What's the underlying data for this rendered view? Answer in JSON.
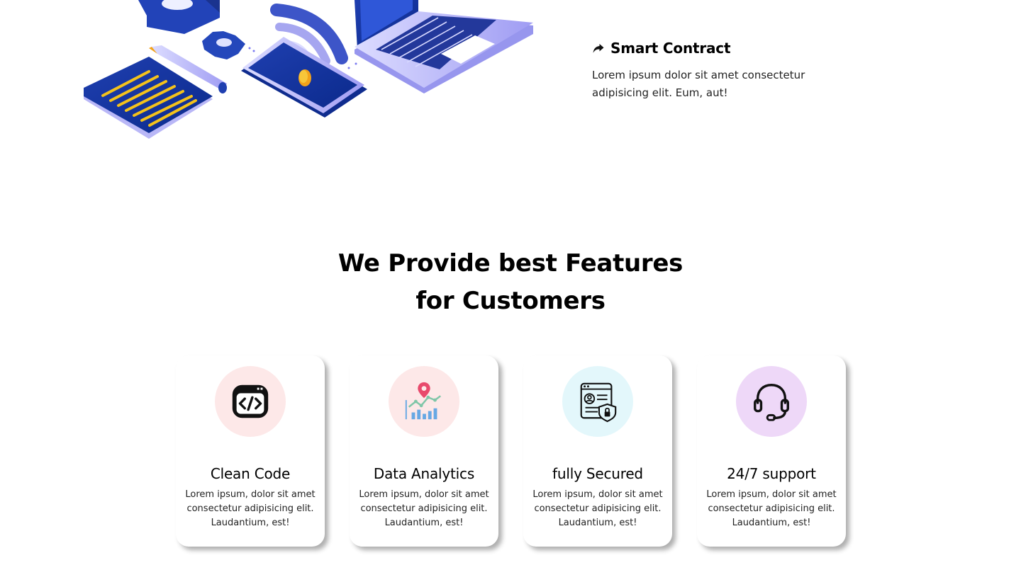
{
  "smart_contract": {
    "icon": "share-arrow-icon",
    "title": "Smart Contract",
    "description": "Lorem ipsum dolor sit amet consectetur adipisicing elit. Eum, aut!"
  },
  "features": {
    "heading_line1": "We Provide best Features",
    "heading_line2": "for Customers",
    "cards": [
      {
        "icon": "code-icon",
        "circle_color": "#fde8e8",
        "title": "Clean Code",
        "description": "Lorem ipsum, dolor sit amet consectetur adipisicing elit. Laudantium, est!"
      },
      {
        "icon": "analytics-icon",
        "circle_color": "#fde8e8",
        "title": "Data Analytics",
        "description": "Lorem ipsum, dolor sit amet consectetur adipisicing elit. Laudantium, est!"
      },
      {
        "icon": "secure-document-icon",
        "circle_color": "#e3f7fb",
        "title": "fully Secured",
        "description": "Lorem ipsum, dolor sit amet consectetur adipisicing elit. Laudantium, est!"
      },
      {
        "icon": "headset-icon",
        "circle_color": "#eed8f8",
        "title": "24/7 support",
        "description": "Lorem ipsum, dolor sit amet consectetur adipisicing elit. Laudantium, est!"
      }
    ]
  }
}
